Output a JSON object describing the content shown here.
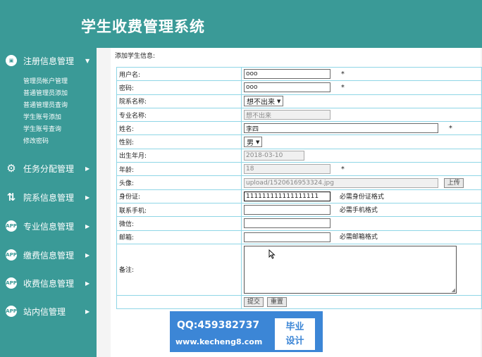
{
  "app": {
    "title": "学生收费管理系统"
  },
  "sidebar": {
    "menus": [
      {
        "label": "注册信息管理",
        "icon": "monitor-icon",
        "icon_text": "▣",
        "arrow": "▼"
      },
      {
        "label": "任务分配管理",
        "icon": "user-gear-icon",
        "icon_text": "⚙",
        "arrow": "▶"
      },
      {
        "label": "院系信息管理",
        "icon": "transfer-icon",
        "icon_text": "⇅",
        "arrow": "▶"
      },
      {
        "label": "专业信息管理",
        "icon": "app-icon",
        "icon_text": "APP",
        "arrow": "▶"
      },
      {
        "label": "缴费信息管理",
        "icon": "app-icon",
        "icon_text": "APP",
        "arrow": "▶"
      },
      {
        "label": "收费信息管理",
        "icon": "app-icon",
        "icon_text": "APP",
        "arrow": "▶"
      },
      {
        "label": "站内信管理",
        "icon": "app-icon",
        "icon_text": "APP",
        "arrow": "▶"
      }
    ],
    "submenu": [
      "管理员帐户管理",
      "普通管理员添加",
      "普通管理员查询",
      "学生账号添加",
      "学生账号查询",
      "修改密码"
    ]
  },
  "form": {
    "heading": "添加学生信息:",
    "required_mark": "*",
    "fields": {
      "username": {
        "label": "用户名:",
        "value": "ooo"
      },
      "password": {
        "label": "密码:",
        "value": "ooo"
      },
      "department": {
        "label": "院系名称:",
        "value": "想不出来"
      },
      "major": {
        "label": "专业名称:",
        "value": "想不出来"
      },
      "name": {
        "label": "姓名:",
        "value": "李四"
      },
      "gender": {
        "label": "性别:",
        "value": "男"
      },
      "birthdate": {
        "label": "出生年月:",
        "value": "2018-03-10"
      },
      "age": {
        "label": "年龄:",
        "value": "18"
      },
      "avatar": {
        "label": "头像:",
        "value": "upload/1520616953324.jpg",
        "upload_label": "上传"
      },
      "idcard": {
        "label": "身份证:",
        "value": "111111111111111111",
        "hint": "必需身份证格式"
      },
      "phone": {
        "label": "联系手机:",
        "value": "",
        "hint": "必需手机格式"
      },
      "wechat": {
        "label": "微信:",
        "value": ""
      },
      "email": {
        "label": "邮箱:",
        "value": "",
        "hint": "必需邮箱格式"
      },
      "remark": {
        "label": "备注:",
        "value": ""
      }
    },
    "submit_label": "提交",
    "reset_label": "重置"
  },
  "watermark": {
    "qq": "QQ:459382737",
    "url": "www.kecheng8.com",
    "logo_line1": "毕业",
    "logo_line2": "设计"
  }
}
